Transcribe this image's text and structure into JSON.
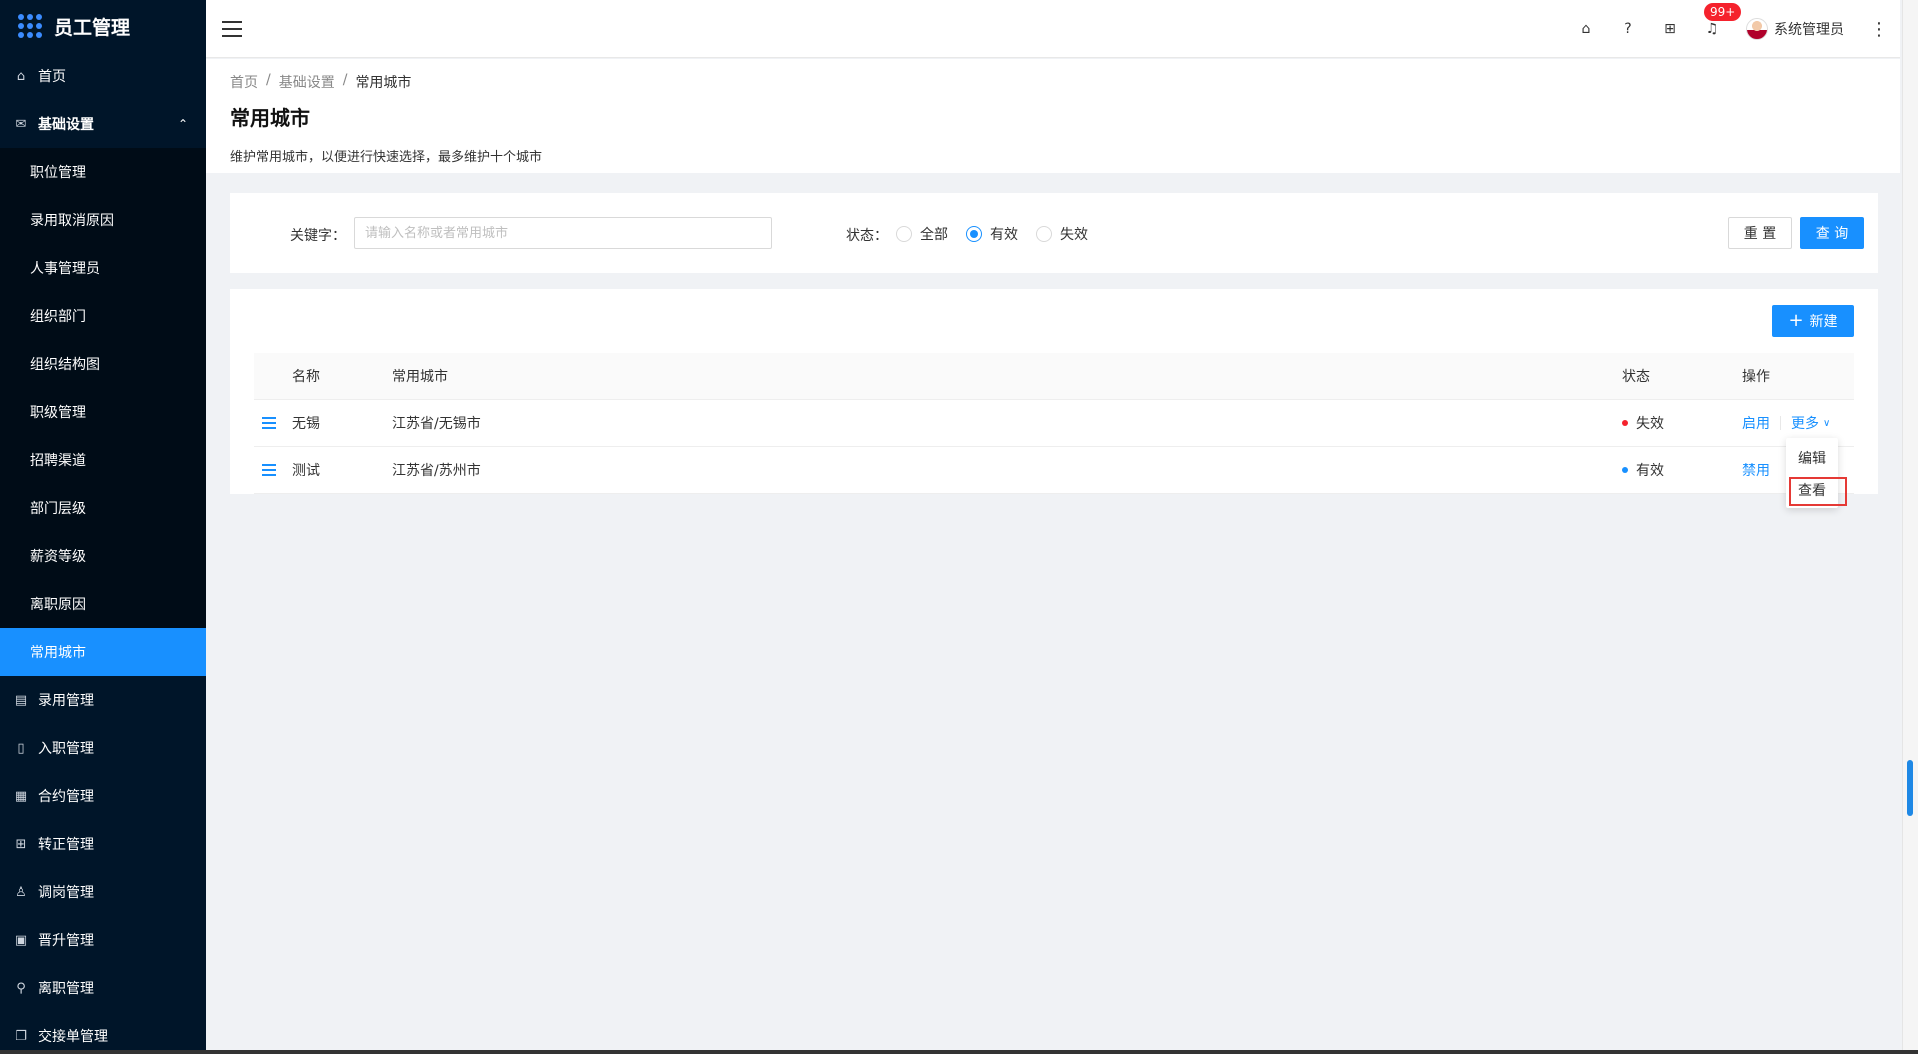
{
  "app": {
    "title": "员工管理"
  },
  "sidebar": {
    "top_items": [
      {
        "label": "首页",
        "icon": "home-icon"
      }
    ],
    "parent": {
      "label": "基础设置",
      "icon": "mail-icon",
      "caret": "⌃"
    },
    "sub_items": [
      {
        "label": "职位管理"
      },
      {
        "label": "录用取消原因"
      },
      {
        "label": "人事管理员"
      },
      {
        "label": "组织部门"
      },
      {
        "label": "组织结构图"
      },
      {
        "label": "职级管理"
      },
      {
        "label": "招聘渠道"
      },
      {
        "label": "部门层级"
      },
      {
        "label": "薪资等级"
      },
      {
        "label": "离职原因"
      },
      {
        "label": "常用城市",
        "active": true
      }
    ],
    "bottom_items": [
      {
        "label": "录用管理",
        "icon": "table-icon"
      },
      {
        "label": "入职管理",
        "icon": "file-icon"
      },
      {
        "label": "合约管理",
        "icon": "calendar-icon"
      },
      {
        "label": "转正管理",
        "icon": "grid-icon"
      },
      {
        "label": "调岗管理",
        "icon": "user-icon"
      },
      {
        "label": "晋升管理",
        "icon": "doc-icon"
      },
      {
        "label": "离职管理",
        "icon": "leave-icon"
      },
      {
        "label": "交接单管理",
        "icon": "copy-icon"
      }
    ]
  },
  "header": {
    "badge": "99+",
    "user_name": "系统管理员"
  },
  "page": {
    "breadcrumb": [
      "首页",
      "基础设置",
      "常用城市"
    ],
    "breadcrumb_sep": "/",
    "title": "常用城市",
    "description": "维护常用城市，以便进行快速选择，最多维护十个城市"
  },
  "filter": {
    "keyword_label": "关键字：",
    "keyword_placeholder": "请输入名称或者常用城市",
    "status_label": "状态：",
    "status_options": [
      {
        "label": "全部",
        "checked": false
      },
      {
        "label": "有效",
        "checked": true
      },
      {
        "label": "失效",
        "checked": false
      }
    ],
    "reset_label": "重 置",
    "query_label": "查 询"
  },
  "table": {
    "new_label": "新建",
    "columns": {
      "name": "名称",
      "city": "常用城市",
      "status": "状态",
      "op": "操作"
    },
    "rows": [
      {
        "name": "无锡",
        "city": "江苏省/无锡市",
        "status": "失效",
        "status_color": "#f5222d",
        "action": "启用",
        "more": "更多"
      },
      {
        "name": "测试",
        "city": "江苏省/苏州市",
        "status": "有效",
        "status_color": "#1890ff",
        "action": "禁用"
      }
    ]
  },
  "dropdown": {
    "items": [
      "编辑",
      "查看"
    ]
  }
}
